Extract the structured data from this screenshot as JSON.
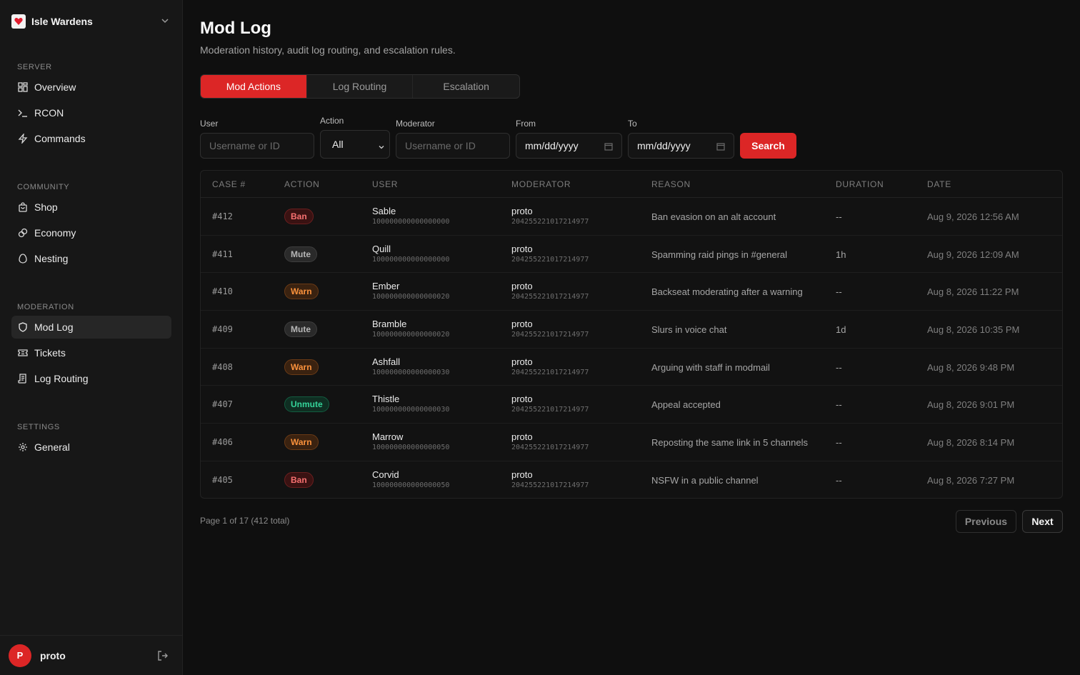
{
  "server": {
    "name": "Isle Wardens"
  },
  "nav": {
    "sections": [
      {
        "heading": "SERVER",
        "items": [
          {
            "label": "Overview",
            "icon": "grid-icon"
          },
          {
            "label": "RCON",
            "icon": "terminal-icon"
          },
          {
            "label": "Commands",
            "icon": "bolt-icon"
          }
        ]
      },
      {
        "heading": "COMMUNITY",
        "items": [
          {
            "label": "Shop",
            "icon": "shopping-bag-icon"
          },
          {
            "label": "Economy",
            "icon": "coins-icon"
          },
          {
            "label": "Nesting",
            "icon": "egg-icon"
          }
        ]
      },
      {
        "heading": "MODERATION",
        "items": [
          {
            "label": "Mod Log",
            "icon": "shield-icon",
            "active": true
          },
          {
            "label": "Tickets",
            "icon": "ticket-icon"
          },
          {
            "label": "Log Routing",
            "icon": "scroll-icon"
          }
        ]
      },
      {
        "heading": "SETTINGS",
        "items": [
          {
            "label": "General",
            "icon": "gear-icon"
          }
        ]
      }
    ]
  },
  "user": {
    "initial": "P",
    "name": "proto"
  },
  "page": {
    "title": "Mod Log",
    "subtitle": "Moderation history, audit log routing, and escalation rules."
  },
  "tabs": [
    "Mod Actions",
    "Log Routing",
    "Escalation"
  ],
  "filters": {
    "user_label": "User",
    "user_placeholder": "Username or ID",
    "action_label": "Action",
    "action_value": "All",
    "moderator_label": "Moderator",
    "moderator_placeholder": "Username or ID",
    "from_label": "From",
    "from_value": "mm/dd/yyyy",
    "to_label": "To",
    "to_value": "mm/dd/yyyy",
    "search_label": "Search"
  },
  "table": {
    "headers": [
      "CASE #",
      "ACTION",
      "USER",
      "MODERATOR",
      "REASON",
      "DURATION",
      "DATE"
    ],
    "rows": [
      {
        "case": "#412",
        "action": "Ban",
        "user": "Sable",
        "user_id": "100000000000000000",
        "mod": "proto",
        "mod_id": "204255221017214977",
        "reason": "Ban evasion on an alt account",
        "duration": "--",
        "date": "Aug 9, 2026 12:56 AM"
      },
      {
        "case": "#411",
        "action": "Mute",
        "user": "Quill",
        "user_id": "100000000000000000",
        "mod": "proto",
        "mod_id": "204255221017214977",
        "reason": "Spamming raid pings in #general",
        "duration": "1h",
        "date": "Aug 9, 2026 12:09 AM"
      },
      {
        "case": "#410",
        "action": "Warn",
        "user": "Ember",
        "user_id": "100000000000000020",
        "mod": "proto",
        "mod_id": "204255221017214977",
        "reason": "Backseat moderating after a warning",
        "duration": "--",
        "date": "Aug 8, 2026 11:22 PM"
      },
      {
        "case": "#409",
        "action": "Mute",
        "user": "Bramble",
        "user_id": "100000000000000020",
        "mod": "proto",
        "mod_id": "204255221017214977",
        "reason": "Slurs in voice chat",
        "duration": "1d",
        "date": "Aug 8, 2026 10:35 PM"
      },
      {
        "case": "#408",
        "action": "Warn",
        "user": "Ashfall",
        "user_id": "100000000000000030",
        "mod": "proto",
        "mod_id": "204255221017214977",
        "reason": "Arguing with staff in modmail",
        "duration": "--",
        "date": "Aug 8, 2026 9:48 PM"
      },
      {
        "case": "#407",
        "action": "Unmute",
        "user": "Thistle",
        "user_id": "100000000000000030",
        "mod": "proto",
        "mod_id": "204255221017214977",
        "reason": "Appeal accepted",
        "duration": "--",
        "date": "Aug 8, 2026 9:01 PM"
      },
      {
        "case": "#406",
        "action": "Warn",
        "user": "Marrow",
        "user_id": "100000000000000050",
        "mod": "proto",
        "mod_id": "204255221017214977",
        "reason": "Reposting the same link in 5 channels",
        "duration": "--",
        "date": "Aug 8, 2026 8:14 PM"
      },
      {
        "case": "#405",
        "action": "Ban",
        "user": "Corvid",
        "user_id": "100000000000000050",
        "mod": "proto",
        "mod_id": "204255221017214977",
        "reason": "NSFW in a public channel",
        "duration": "--",
        "date": "Aug 8, 2026 7:27 PM"
      }
    ]
  },
  "pagination": {
    "info": "Page 1 of 17 (412 total)",
    "prev": "Previous",
    "next": "Next"
  },
  "colors": {
    "accent": "#dc2626",
    "background": "#0f0f0f",
    "sidebar": "#171717"
  }
}
